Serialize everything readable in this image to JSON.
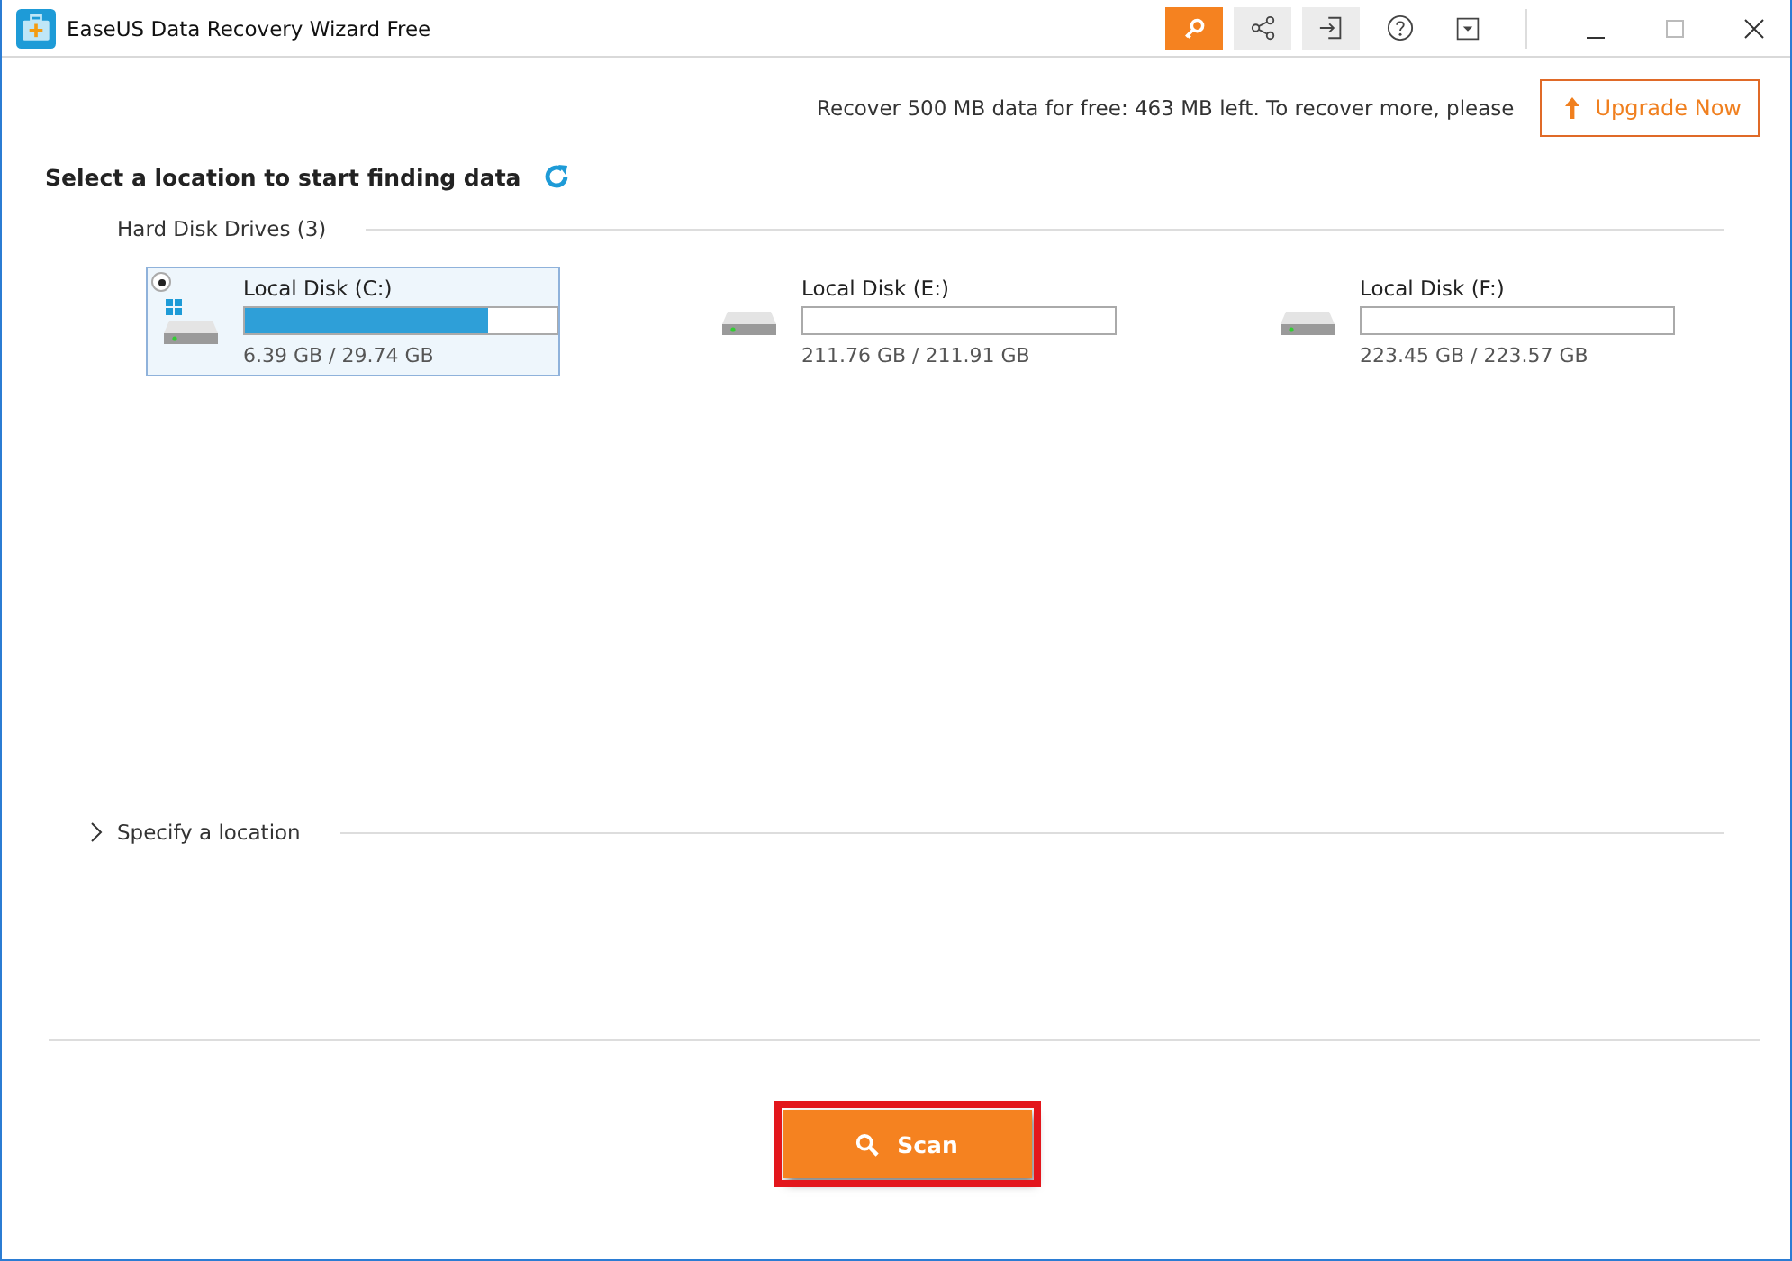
{
  "window": {
    "title": "EaseUS Data Recovery Wizard Free"
  },
  "toolbar": [
    {
      "kind": "key",
      "selected": true
    },
    {
      "kind": "share",
      "selected": false
    },
    {
      "kind": "login",
      "selected": false
    },
    {
      "kind": "help",
      "selected": false
    },
    {
      "kind": "dropdown",
      "selected": false
    }
  ],
  "notice": {
    "text": "Recover 500 MB data for free: 463 MB left. To recover more, please",
    "button": "Upgrade Now"
  },
  "heading": "Select a location to start finding data",
  "drives_section": {
    "label": "Hard Disk Drives (3)",
    "drives": [
      {
        "name": "Local Disk (C:)",
        "size": "6.39 GB / 29.74 GB",
        "level": 0.78,
        "selected": true,
        "system": true
      },
      {
        "name": "Local Disk (E:)",
        "size": "211.76 GB / 211.91 GB",
        "level": 0,
        "selected": false,
        "system": false
      },
      {
        "name": "Local Disk (F:)",
        "size": "223.45 GB / 223.57 GB",
        "level": 0,
        "selected": false,
        "system": false
      }
    ]
  },
  "specify": {
    "label": "Specify a location",
    "expanded": false
  },
  "scan_button": {
    "label": "Scan",
    "highlighted": true
  }
}
